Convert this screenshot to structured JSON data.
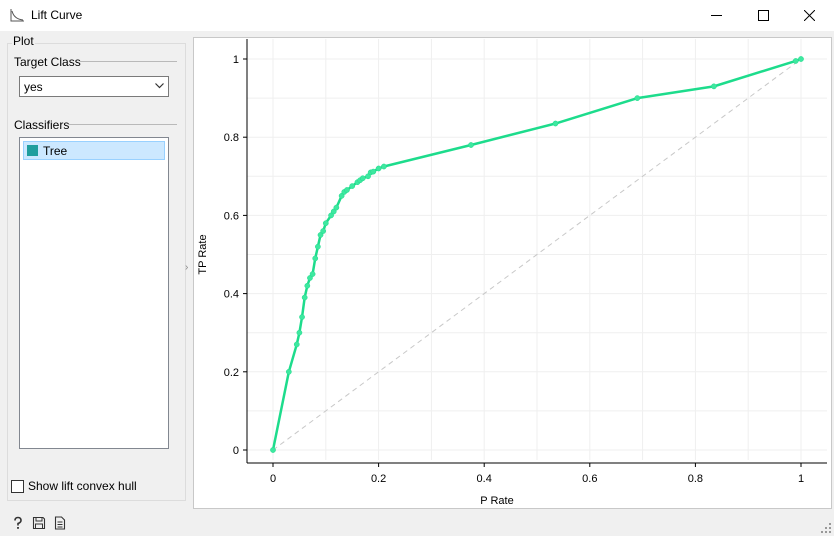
{
  "window": {
    "title": "Lift Curve"
  },
  "sidebar": {
    "plot_group": "Plot",
    "target_class_label": "Target Class",
    "target_class_value": "yes",
    "classifiers_label": "Classifiers",
    "classifiers": [
      {
        "label": "Tree",
        "color": "#1f9e9e"
      }
    ],
    "convex_hull_label": "Show lift convex hull",
    "convex_hull_checked": false
  },
  "colors": {
    "curve": "#1ddc8c",
    "diagonal": "#c8c8c8",
    "selection": "#cce8ff"
  },
  "chart_data": {
    "type": "line",
    "xlabel": "P Rate",
    "ylabel": "TP Rate",
    "xlim": [
      0,
      1
    ],
    "ylim": [
      0,
      1
    ],
    "x_ticks": [
      "0",
      "0.2",
      "0.4",
      "0.6",
      "0.8",
      "1"
    ],
    "y_ticks": [
      "0",
      "0.2",
      "0.4",
      "0.6",
      "0.8",
      "1"
    ],
    "grid": true,
    "series": [
      {
        "name": "Tree",
        "x": [
          0,
          0.03,
          0.045,
          0.05,
          0.055,
          0.06,
          0.065,
          0.07,
          0.075,
          0.08,
          0.085,
          0.09,
          0.095,
          0.1,
          0.11,
          0.115,
          0.12,
          0.13,
          0.135,
          0.14,
          0.15,
          0.16,
          0.165,
          0.17,
          0.18,
          0.185,
          0.19,
          0.2,
          0.21,
          0.375,
          0.535,
          0.69,
          0.835,
          0.99,
          1
        ],
        "y": [
          0,
          0.2,
          0.27,
          0.3,
          0.34,
          0.39,
          0.42,
          0.44,
          0.45,
          0.49,
          0.52,
          0.55,
          0.56,
          0.58,
          0.6,
          0.61,
          0.62,
          0.65,
          0.66,
          0.665,
          0.675,
          0.685,
          0.69,
          0.695,
          0.7,
          0.71,
          0.712,
          0.72,
          0.725,
          0.78,
          0.835,
          0.9,
          0.93,
          0.995,
          1
        ]
      },
      {
        "name": "",
        "x": [
          0,
          1
        ],
        "y": [
          0,
          1
        ]
      }
    ]
  }
}
